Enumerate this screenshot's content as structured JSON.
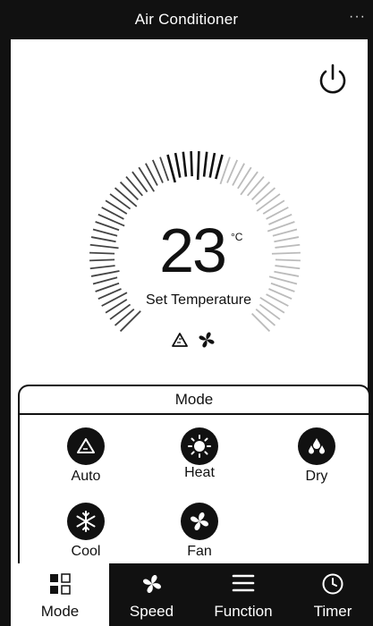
{
  "header": {
    "title": "Air Conditioner",
    "more": "···"
  },
  "temperature": {
    "value": "23",
    "unit": "°C",
    "label": "Set Temperature"
  },
  "mode_panel": {
    "title": "Mode",
    "options": [
      {
        "label": "Auto",
        "icon": "auto-triangle-icon"
      },
      {
        "label": "Heat",
        "icon": "sun-icon"
      },
      {
        "label": "Dry",
        "icon": "droplets-icon"
      },
      {
        "label": "Cool",
        "icon": "snowflake-icon"
      },
      {
        "label": "Fan",
        "icon": "fan-icon"
      }
    ]
  },
  "tabs": [
    {
      "label": "Mode",
      "icon": "mode-grid-icon",
      "active": true
    },
    {
      "label": "Speed",
      "icon": "fan-icon",
      "active": false
    },
    {
      "label": "Function",
      "icon": "menu-icon",
      "active": false
    },
    {
      "label": "Timer",
      "icon": "clock-icon",
      "active": false
    }
  ],
  "colors": {
    "dark": "#111111",
    "background": "#ffffff"
  }
}
